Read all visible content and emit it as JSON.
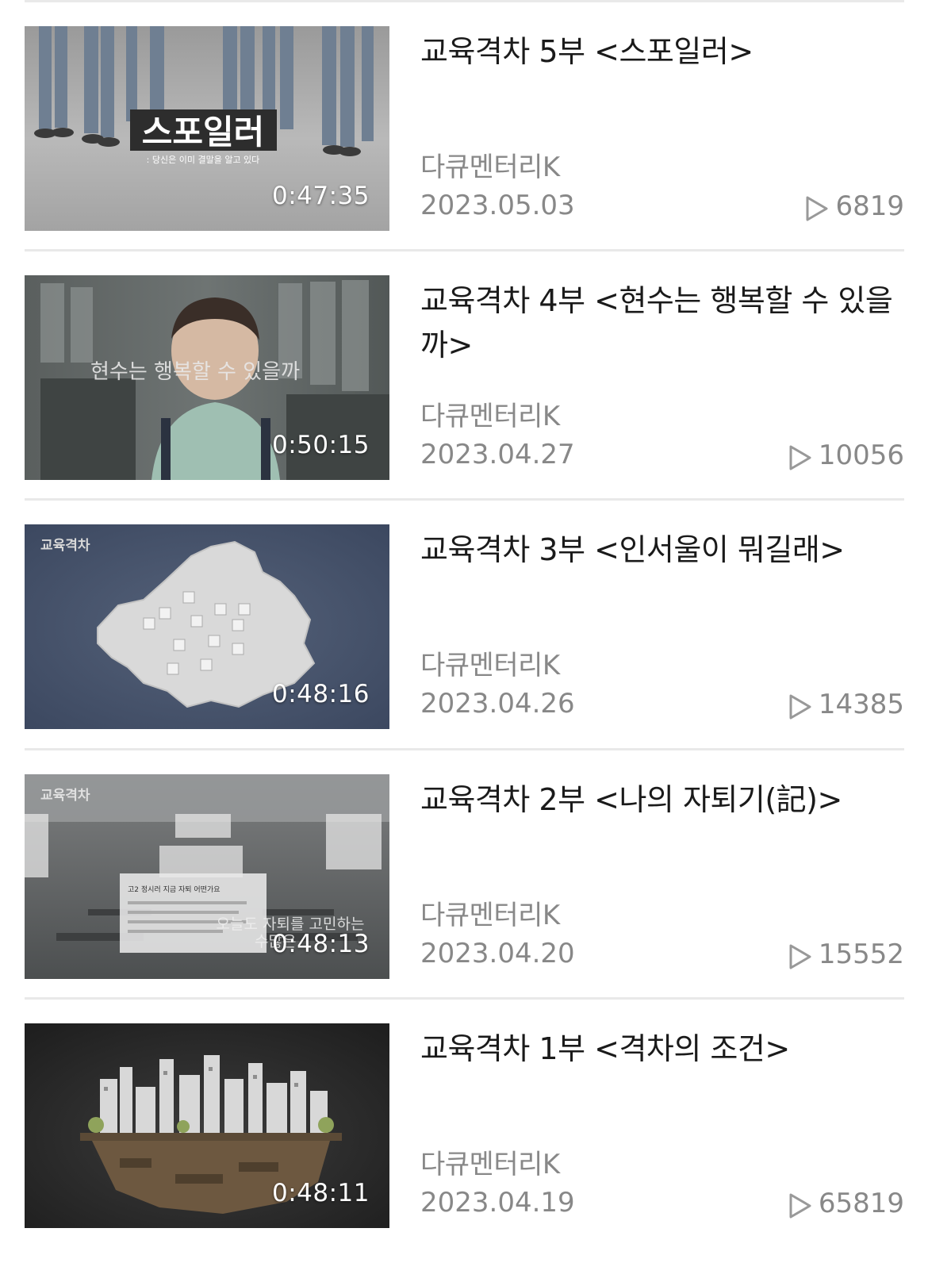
{
  "videos": [
    {
      "title": "교육격차 5부 <스포일러>",
      "channel": "다큐멘터리K",
      "date": "2023.05.03",
      "views": "6819",
      "duration": "0:47:35",
      "thumb_text": "스포일러",
      "thumb_subtext": ": 당신은 이미 결말을 알고 있다"
    },
    {
      "title": "교육격차 4부 <현수는 행복할 수 있을까>",
      "channel": "다큐멘터리K",
      "date": "2023.04.27",
      "views": "10056",
      "duration": "0:50:15",
      "thumb_text": "현수는 행복할 수 있을까"
    },
    {
      "title": "교육격차 3부 <인서울이 뭐길래>",
      "channel": "다큐멘터리K",
      "date": "2023.04.26",
      "views": "14385",
      "duration": "0:48:16",
      "thumb_logo": "교육격차"
    },
    {
      "title": "교육격차 2부 <나의 자퇴기(記)>",
      "channel": "다큐멘터리K",
      "date": "2023.04.20",
      "views": "15552",
      "duration": "0:48:13",
      "thumb_logo": "교육격차",
      "thumb_text": "오늘도 자퇴를 고민하는",
      "thumb_subtext": "수많은",
      "thumb_card": "고2 정시러 지금 자퇴 어떤가요"
    },
    {
      "title": "교육격차 1부 <격차의 조건>",
      "channel": "다큐멘터리K",
      "date": "2023.04.19",
      "views": "65819",
      "duration": "0:48:11"
    }
  ]
}
